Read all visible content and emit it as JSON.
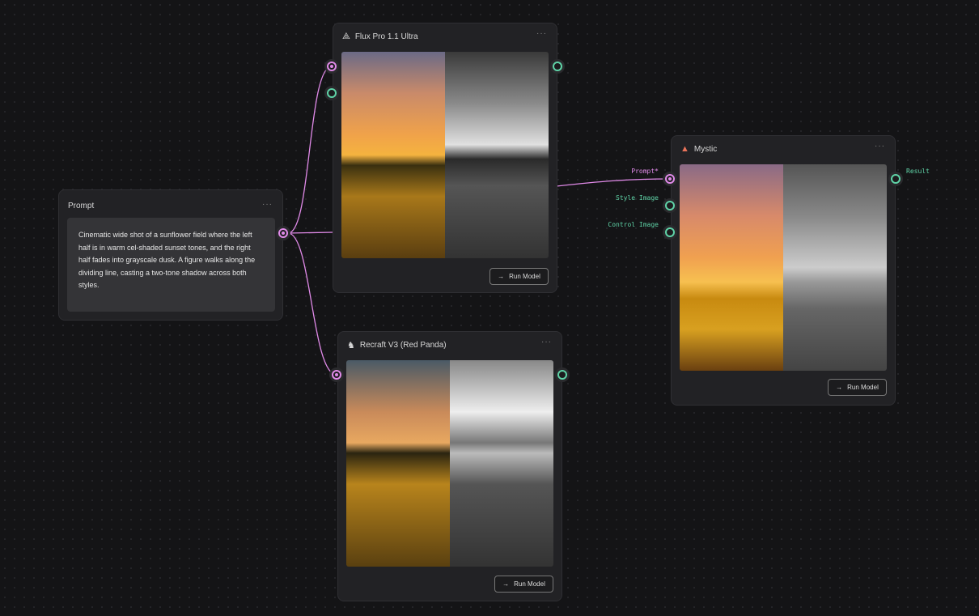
{
  "prompt_node": {
    "title": "Prompt",
    "menu": "···",
    "text": "Cinematic wide shot of a sunflower field where the left half is in warm cel-shaded sunset tones, and the right half fades into grayscale dusk. A figure walks along the dividing line, casting a two-tone shadow across both styles."
  },
  "flux_node": {
    "title": "Flux Pro 1.1 Ultra",
    "menu": "···",
    "run_label": "Run Model"
  },
  "recraft_node": {
    "title": "Recraft V3 (Red Panda)",
    "menu": "···",
    "run_label": "Run Model"
  },
  "mystic_node": {
    "title": "Mystic",
    "menu": "···",
    "run_label": "Run Model",
    "inputs": {
      "prompt": "Prompt*",
      "style_image": "Style Image",
      "control_image": "Control Image"
    },
    "output": "Result"
  },
  "colors": {
    "wire": "#e08ae8",
    "port_image": "#5fd3a7",
    "port_text": "#e08ae8"
  }
}
